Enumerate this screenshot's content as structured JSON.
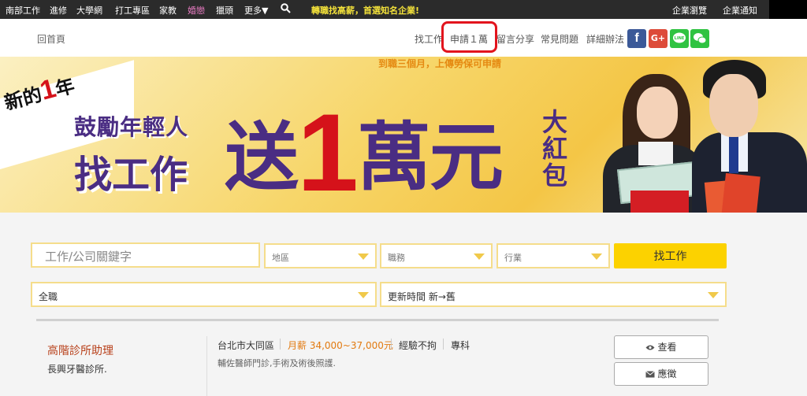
{
  "topbar": {
    "items": [
      "南部工作",
      "進修",
      "大學網",
      "打工專區",
      "家教",
      "婚戀",
      "獵頭",
      "更多▼"
    ],
    "promo": "轉職找高薪，首選知名企業!",
    "right_items": [
      "企業瀏覽",
      "企業通知"
    ]
  },
  "nav": {
    "home": "回首頁",
    "links": [
      "找工作",
      "申請１萬",
      "留言分享",
      "常見問題",
      "詳細辦法"
    ],
    "social": [
      "f",
      "G+",
      "LINE",
      "WeChat"
    ]
  },
  "banner": {
    "notice": "到職三個月，上傳勞保可申請",
    "new_year_a": "新的",
    "new_year_num": "1",
    "new_year_b": "年",
    "encourage": "鼓勵年輕人",
    "find_job": "找工作",
    "send": "送",
    "amount": "1",
    "currency": "萬元",
    "red_envelope": "大紅包"
  },
  "search": {
    "keyword_placeholder": "工作/公司關鍵字",
    "area": "地區",
    "job_type": "職務",
    "industry": "行業",
    "button": "找工作",
    "employment": "全職",
    "sort": "更新時間 新→舊"
  },
  "job": {
    "title": "高階診所助理",
    "company": "長興牙醫診所.",
    "location": "台北市大同區",
    "salary": "月薪 34,000~37,000元",
    "experience": "經驗不拘",
    "education": "專科",
    "description": "輔佐醫師門診,手術及術後照護.",
    "view_label": "查看",
    "apply_label": "應徵"
  },
  "colors": {
    "accent_yellow": "#fcd200",
    "highlight_red": "#e2141d",
    "banner_purple": "#4a2d83",
    "salary_orange": "#e27a10"
  }
}
